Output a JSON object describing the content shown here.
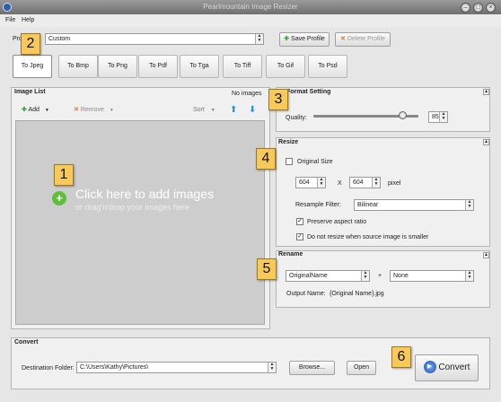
{
  "window": {
    "title": "Pearlmountain Image Resizer"
  },
  "menu": {
    "file": "File",
    "help": "Help"
  },
  "profile": {
    "label": "Profile:",
    "value": "Custom",
    "save": "Save Profile",
    "delete": "Delete Profile"
  },
  "tabs": [
    "To Jpeg",
    "To Bmp",
    "To Png",
    "To Pdf",
    "To Tga",
    "To Tiff",
    "To Gif",
    "To Psd"
  ],
  "image_list": {
    "title": "Image List",
    "count": "No images",
    "add": "Add",
    "remove": "Remove",
    "sort": "Sort",
    "drop_main": "Click here  to add images",
    "drop_sub": "or drag'n'drop your images here"
  },
  "format": {
    "title": "Format Setting",
    "quality_label": "Quality:",
    "quality": "85",
    "quality_fraction": 0.85
  },
  "resize": {
    "title": "Resize",
    "original_size": "Original Size",
    "width": "604",
    "x": "X",
    "height": "604",
    "unit": "pixel",
    "filter_label": "Resample Filter:",
    "filter": "Bilinear",
    "aspect": "Preserve aspect ratio",
    "no_resize": "Do not resize when source image is smaller"
  },
  "rename": {
    "title": "Rename",
    "name": "OriginalName",
    "plus": "+",
    "suffix": "None",
    "output_label": "Output Name:",
    "output": "{Original Name}.jpg"
  },
  "convert": {
    "title": "Convert",
    "dest_label": "Destination Folder:",
    "dest": "C:\\Users\\Kathy\\Pictures\\",
    "browse": "Browse...",
    "open": "Open",
    "button": "Convert"
  },
  "badges": [
    "1",
    "2",
    "3",
    "4",
    "5",
    "6"
  ]
}
